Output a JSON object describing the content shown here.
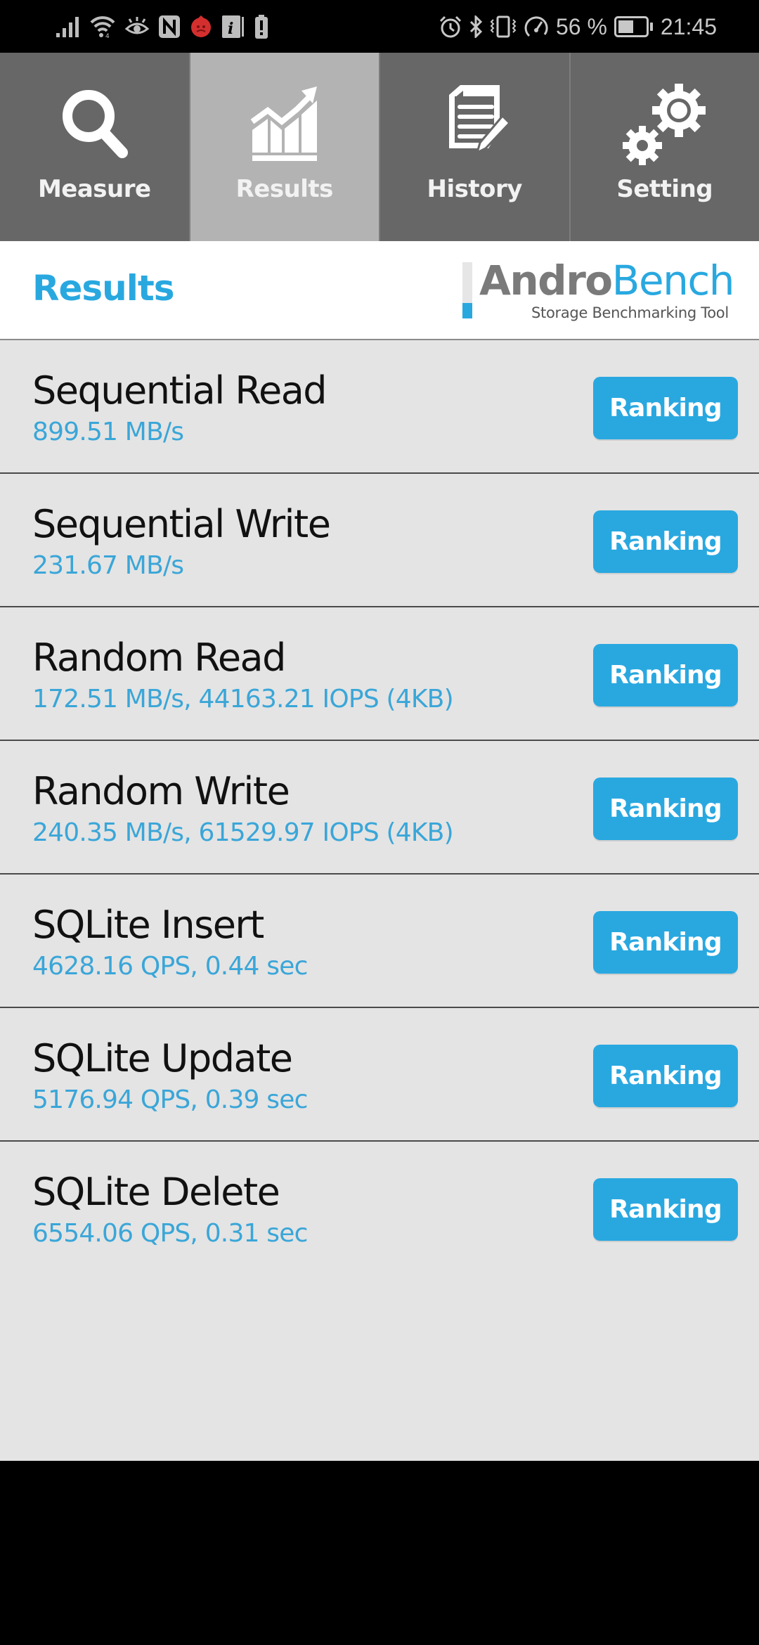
{
  "status_bar": {
    "left_icons": [
      "signal-icon",
      "wifi-icon",
      "eye-comfort-icon",
      "nfc-icon",
      "antutu-icon",
      "info-notification-icon",
      "battery-alert-icon"
    ],
    "right_icons": [
      "alarm-icon",
      "bluetooth-icon",
      "vibrate-icon",
      "speedometer-icon"
    ],
    "battery_percent": "56 %",
    "battery_level": 0.56,
    "time": "21:45"
  },
  "nav": {
    "tabs": [
      {
        "label": "Measure",
        "icon": "search-icon",
        "active": false
      },
      {
        "label": "Results",
        "icon": "chart-icon",
        "active": true
      },
      {
        "label": "History",
        "icon": "document-edit-icon",
        "active": false
      },
      {
        "label": "Setting",
        "icon": "gears-icon",
        "active": false
      }
    ]
  },
  "header": {
    "title": "Results",
    "logo": {
      "part1": "Andro",
      "part2": "Bench",
      "tagline": "Storage Benchmarking Tool"
    }
  },
  "results": [
    {
      "title": "Sequential Read",
      "value": "899.51 MB/s",
      "button": "Ranking"
    },
    {
      "title": "Sequential Write",
      "value": "231.67 MB/s",
      "button": "Ranking"
    },
    {
      "title": "Random Read",
      "value": "172.51 MB/s, 44163.21 IOPS (4KB)",
      "button": "Ranking"
    },
    {
      "title": "Random Write",
      "value": "240.35 MB/s, 61529.97 IOPS (4KB)",
      "button": "Ranking"
    },
    {
      "title": "SQLite Insert",
      "value": "4628.16 QPS, 0.44 sec",
      "button": "Ranking"
    },
    {
      "title": "SQLite Update",
      "value": "5176.94 QPS, 0.39 sec",
      "button": "Ranking"
    },
    {
      "title": "SQLite Delete",
      "value": "6554.06 QPS, 0.31 sec",
      "button": "Ranking"
    }
  ],
  "colors": {
    "accent": "#29a8e0",
    "tab_bg": "#676767",
    "tab_active_bg": "#b3b3b3",
    "list_bg": "#e4e4e4",
    "value_text": "#3aa6d8"
  }
}
